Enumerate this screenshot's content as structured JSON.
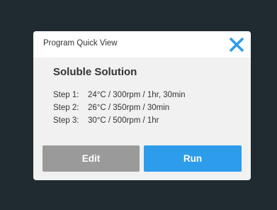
{
  "dialog": {
    "title": "Program Quick View",
    "program_name": "Soluble Solution",
    "steps": [
      {
        "label": "Step 1:",
        "value": "24°C / 300rpm / 1hr, 30min"
      },
      {
        "label": "Step 2:",
        "value": "26°C / 350rpm / 30min"
      },
      {
        "label": "Step 3:",
        "value": "30°C / 500rpm / 1hr"
      }
    ],
    "close_icon": "close-icon",
    "edit_label": "Edit",
    "run_label": "Run"
  },
  "colors": {
    "background": "#1f2b31",
    "dialog_body": "#f0f1f0",
    "dialog_header": "#ffffff",
    "accent": "#2d9ceb",
    "edit_button": "#9a9a9a",
    "text": "#333333"
  }
}
